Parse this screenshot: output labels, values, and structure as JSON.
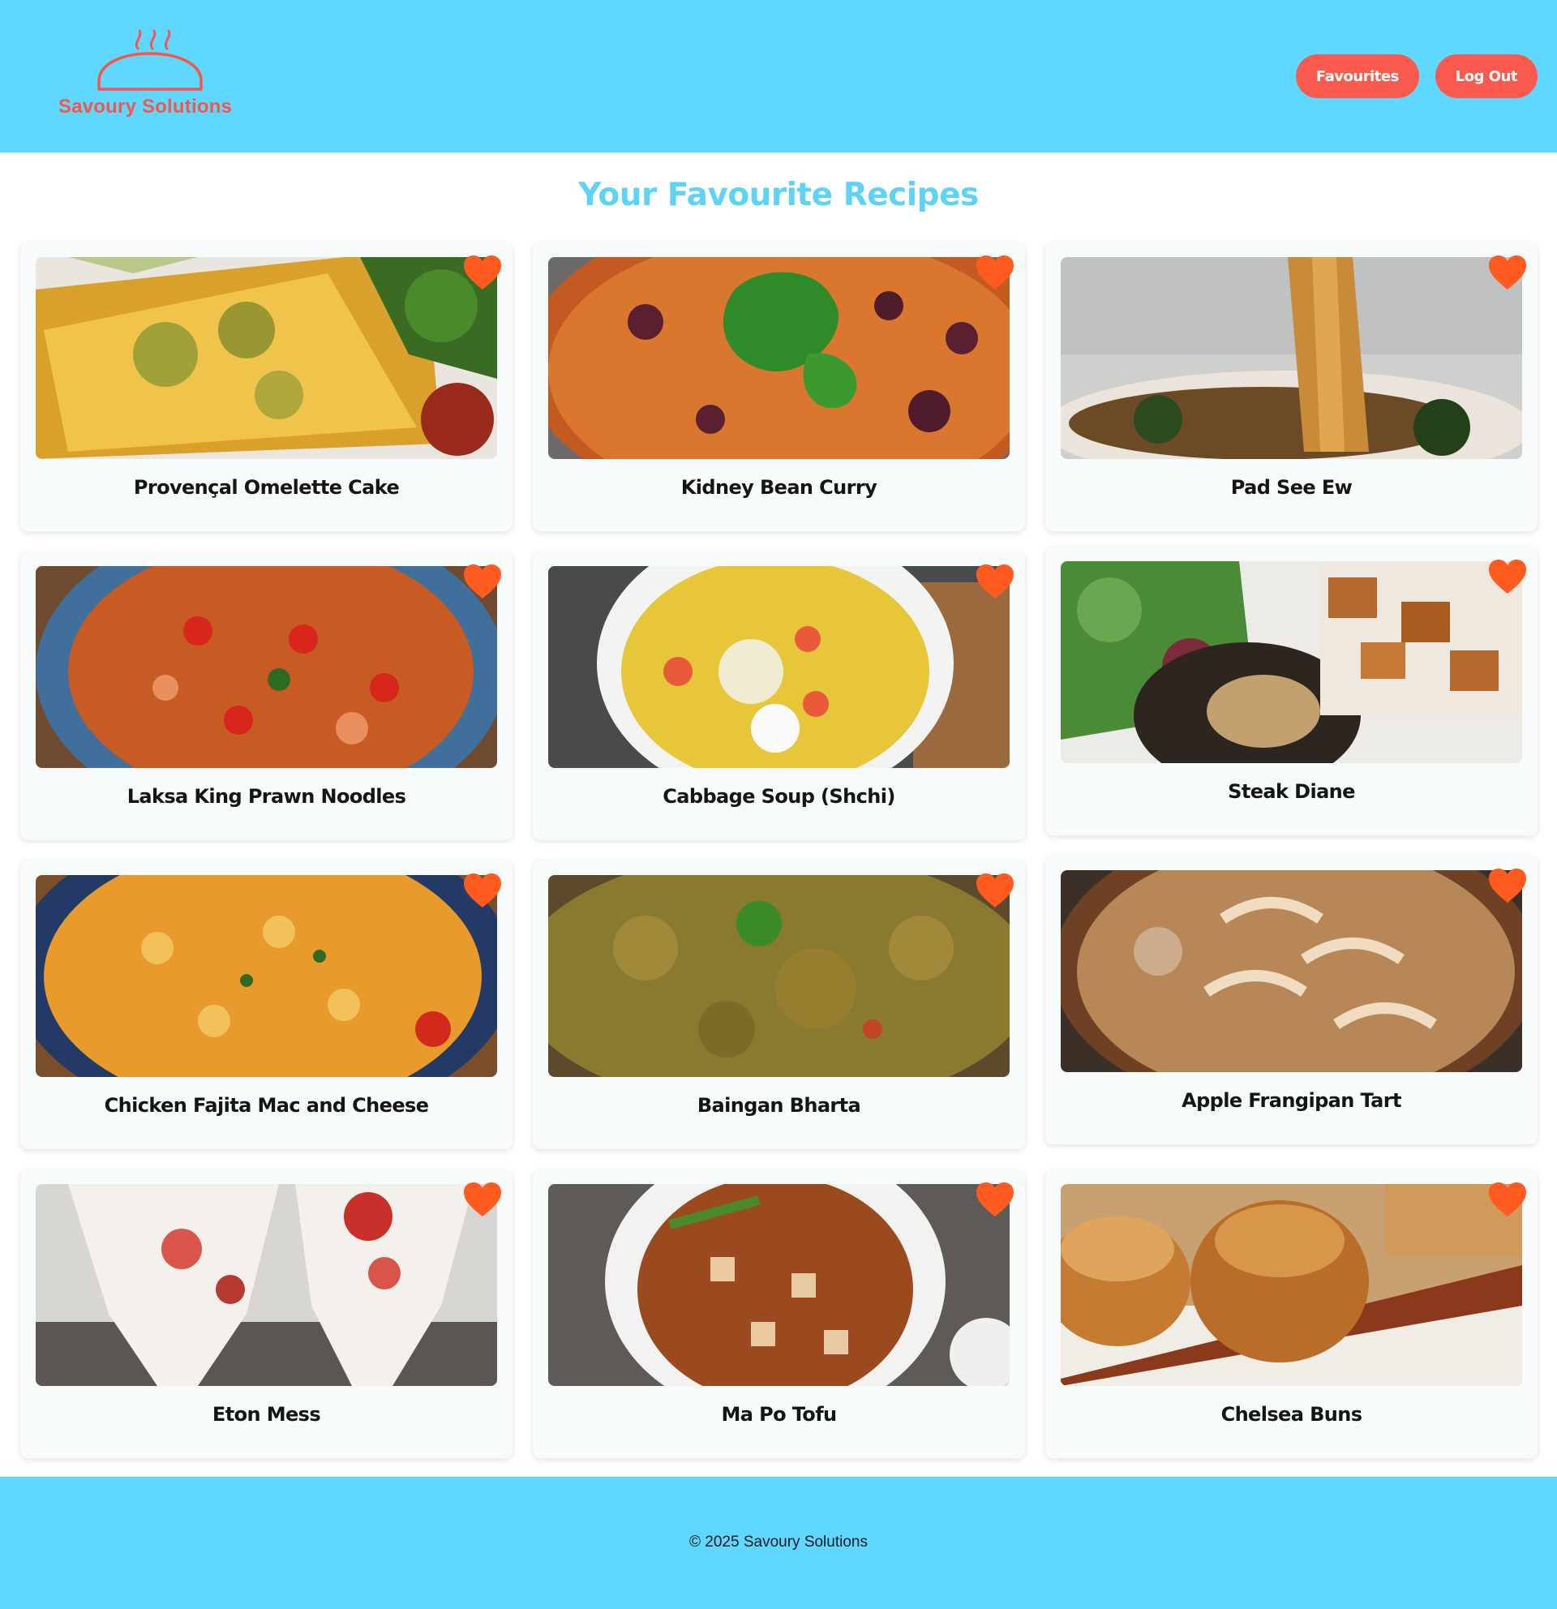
{
  "header": {
    "logo_text": "Savoury Solutions",
    "nav": {
      "favourites_label": "Favourites",
      "logout_label": "Log Out"
    }
  },
  "main": {
    "title": "Your Favourite Recipes",
    "recipes": [
      {
        "title": "Provençal Omelette Cake",
        "image": "omelette-cake-photo",
        "favourited": true
      },
      {
        "title": "Kidney Bean Curry",
        "image": "bean-curry-photo",
        "favourited": true
      },
      {
        "title": "Pad See Ew",
        "image": "noodles-photo",
        "favourited": true
      },
      {
        "title": "Laksa King Prawn Noodles",
        "image": "prawn-noodles-photo",
        "favourited": true
      },
      {
        "title": "Cabbage Soup (Shchi)",
        "image": "cabbage-soup-photo",
        "favourited": true
      },
      {
        "title": "Steak Diane",
        "image": "steak-photo",
        "favourited": true
      },
      {
        "title": "Chicken Fajita Mac and Cheese",
        "image": "mac-cheese-photo",
        "favourited": true
      },
      {
        "title": "Baingan Bharta",
        "image": "baingan-bharta-photo",
        "favourited": true
      },
      {
        "title": "Apple Frangipan Tart",
        "image": "apple-tart-photo",
        "favourited": true
      },
      {
        "title": "Eton Mess",
        "image": "eton-mess-photo",
        "favourited": true
      },
      {
        "title": "Ma Po Tofu",
        "image": "mapo-tofu-photo",
        "favourited": true
      },
      {
        "title": "Chelsea Buns",
        "image": "chelsea-buns-photo",
        "favourited": true
      }
    ]
  },
  "footer": {
    "text": "© 2025 Savoury Solutions"
  },
  "colors": {
    "header_bg": "#5fd7ff",
    "accent": "#fa5a4d",
    "heart": "#ff5a1f",
    "title": "#5fd3f5"
  }
}
